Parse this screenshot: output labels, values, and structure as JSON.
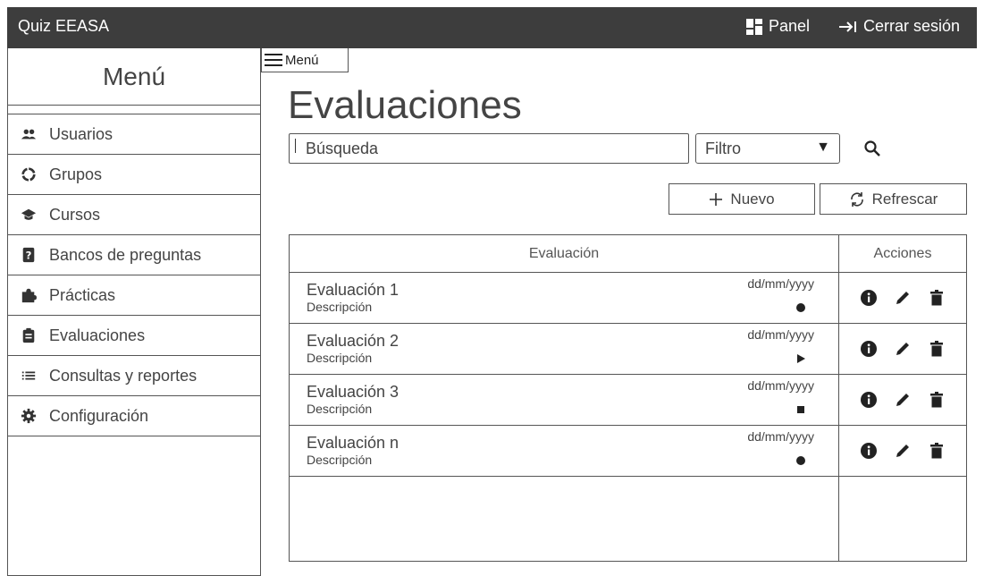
{
  "app": {
    "title": "Quiz EEASA"
  },
  "topbar": {
    "panel_label": "Panel",
    "logout_label": "Cerrar sesión"
  },
  "sidebar": {
    "title": "Menú",
    "items": [
      {
        "label": "Usuarios",
        "icon": "users-icon"
      },
      {
        "label": "Grupos",
        "icon": "groups-icon"
      },
      {
        "label": "Cursos",
        "icon": "graduation-cap-icon"
      },
      {
        "label": "Bancos de preguntas",
        "icon": "question-bank-icon"
      },
      {
        "label": "Prácticas",
        "icon": "puzzle-icon"
      },
      {
        "label": "Evaluaciones",
        "icon": "clipboard-icon"
      },
      {
        "label": "Consultas y reportes",
        "icon": "list-icon"
      },
      {
        "label": "Configuración",
        "icon": "gear-icon"
      }
    ]
  },
  "menu_toggle": {
    "label": "Menú"
  },
  "page": {
    "title": "Evaluaciones"
  },
  "search": {
    "placeholder": "Búsqueda"
  },
  "filter": {
    "selected": "Filtro"
  },
  "actions": {
    "new_label": "Nuevo",
    "refresh_label": "Refrescar"
  },
  "table": {
    "headers": {
      "evaluation": "Evaluación",
      "actions": "Acciones"
    },
    "rows": [
      {
        "name": "Evaluación 1",
        "description": "Descripción",
        "date": "dd/mm/yyyy",
        "status": "circle"
      },
      {
        "name": "Evaluación 2",
        "description": "Descripción",
        "date": "dd/mm/yyyy",
        "status": "play"
      },
      {
        "name": "Evaluación 3",
        "description": "Descripción",
        "date": "dd/mm/yyyy",
        "status": "stop"
      },
      {
        "name": "Evaluación n",
        "description": "Descripción",
        "date": "dd/mm/yyyy",
        "status": "circle"
      }
    ]
  },
  "colors": {
    "topbar_bg": "#3d3d3d",
    "border": "#555555",
    "text": "#444444"
  }
}
